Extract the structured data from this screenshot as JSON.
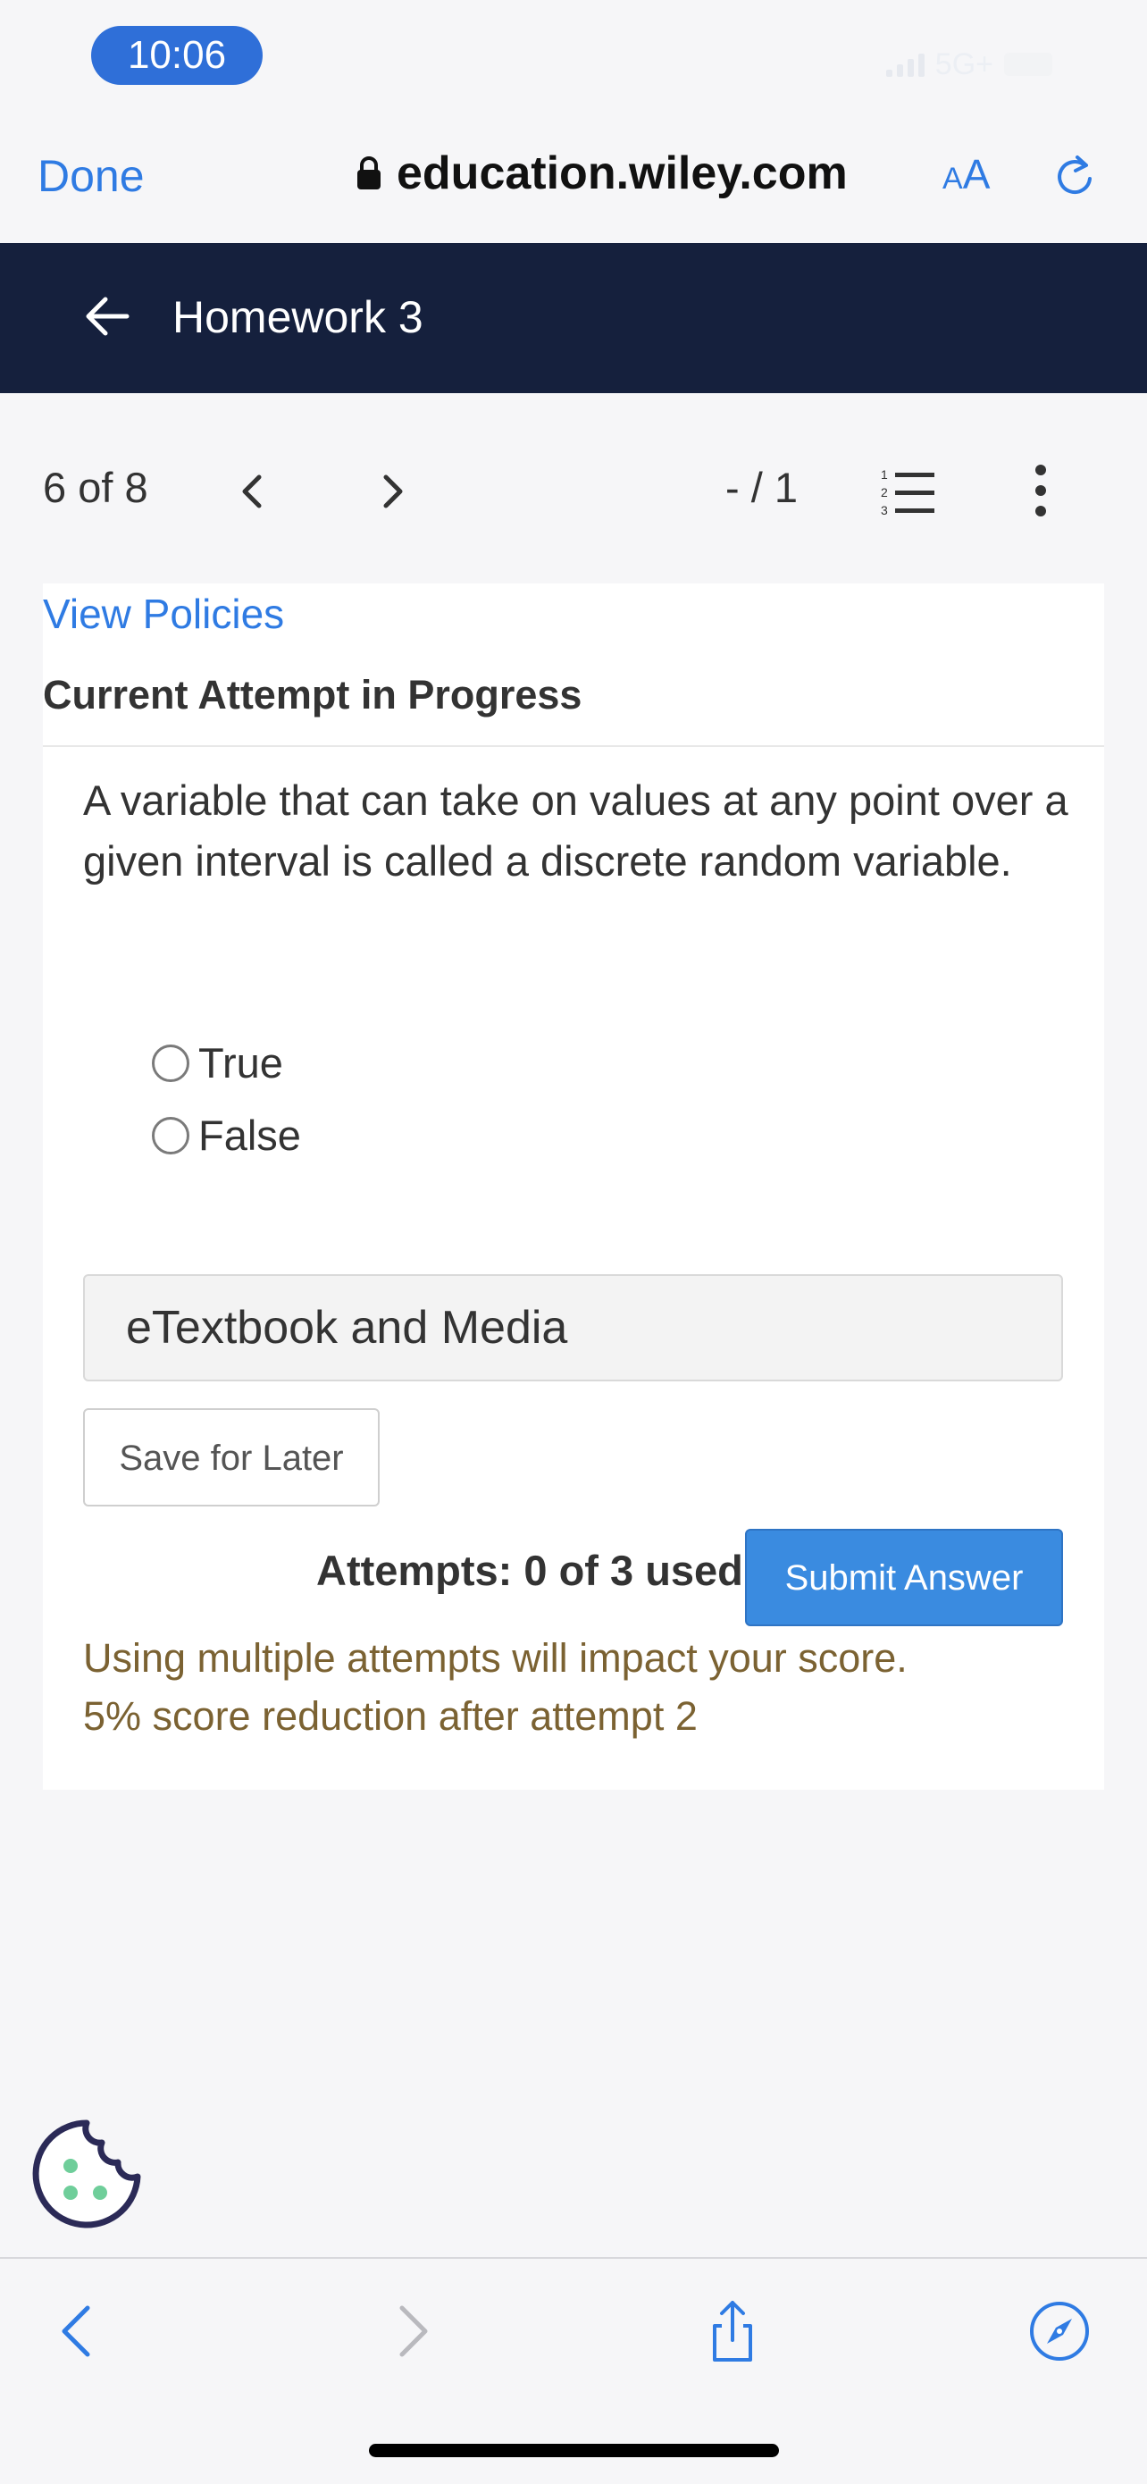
{
  "status_bar": {
    "time": "10:06",
    "network": "5G+"
  },
  "browser": {
    "done_label": "Done",
    "url": "education.wiley.com",
    "text_size_small": "A",
    "text_size_large": "A"
  },
  "header": {
    "title": "Homework 3"
  },
  "nav": {
    "position": "6 of 8",
    "score": "- / 1"
  },
  "card": {
    "view_policies": "View Policies",
    "attempt_title": "Current Attempt in Progress",
    "question": "A variable that can take on values at any point over a given interval is called a discrete random variable.",
    "options": [
      {
        "label": "True",
        "selected": false
      },
      {
        "label": "False",
        "selected": false
      }
    ],
    "etextbook_label": "eTextbook and Media",
    "save_label": "Save for Later",
    "attempts_text": "Attempts: 0 of 3 used",
    "submit_label": "Submit Answer",
    "warning_line1": "Using multiple attempts will impact your score.",
    "warning_line2": "5% score reduction after attempt 2"
  },
  "colors": {
    "accent": "#2f7be3",
    "header_bg": "#15203d",
    "submit_bg": "#3a8be0",
    "warning_text": "#7b6232",
    "cookie_dots": "#6fce9a"
  },
  "icons": {
    "lock": "lock-icon",
    "reload": "reload-icon",
    "back_arrow": "arrow-left-icon",
    "prev": "chevron-left-icon",
    "next": "chevron-right-icon",
    "list": "numbered-list-icon",
    "more": "more-vertical-icon",
    "cookie": "cookie-icon",
    "share": "share-icon",
    "compass": "compass-icon"
  }
}
